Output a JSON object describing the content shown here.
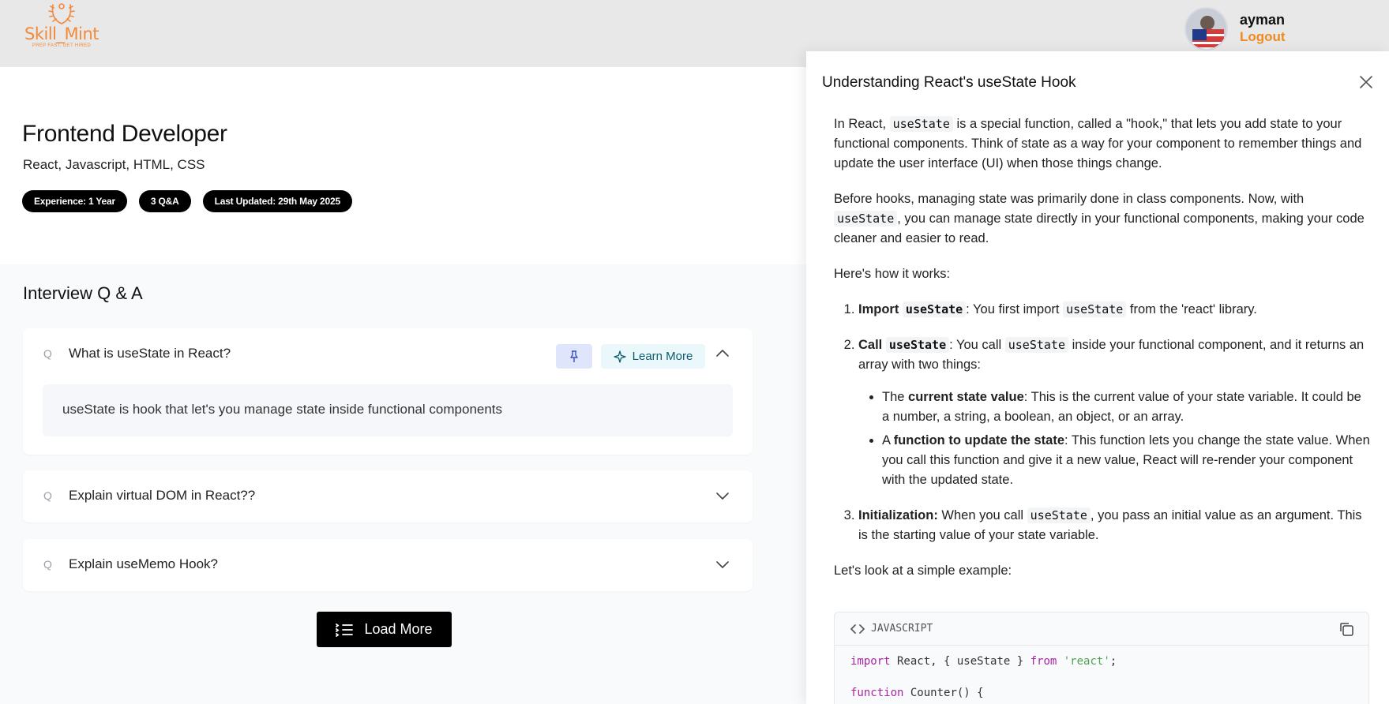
{
  "brand": {
    "name": "Skill_Mint",
    "tagline": "PREP FAST, GET HIRED",
    "accent": "#f08a3c"
  },
  "user": {
    "name": "ayman",
    "logout_label": "Logout"
  },
  "role": {
    "title": "Frontend Developer",
    "skills": "React, Javascript, HTML, CSS",
    "tags": [
      "Experience: 1 Year",
      "3 Q&A",
      "Last Updated: 29th May 2025"
    ]
  },
  "qa": {
    "heading": "Interview Q & A",
    "q_prefix": "Q",
    "items": [
      {
        "question": "What is useState in React?",
        "answer": "useState is hook that let's you manage state inside functional components",
        "expanded": true
      },
      {
        "question": "Explain virtual DOM in React??",
        "expanded": false
      },
      {
        "question": "Explain useMemo Hook?",
        "expanded": false
      }
    ],
    "learn_more_label": "Learn More",
    "load_more_label": "Load More"
  },
  "drawer": {
    "title": "Understanding React's useState Hook",
    "intro_a": "In React, ",
    "code_usestate": "useState",
    "intro_b": " is a special function, called a \"hook,\" that lets you add state to your functional components. Think of state as a way for your component to remember things and update the user interface (UI) when those things change.",
    "p2_a": "Before hooks, managing state was primarily done in class components. Now, with ",
    "p2_b": ", you can manage state directly in your functional components, making your code cleaner and easier to read.",
    "p3": "Here's how it works:",
    "step1_label": "Import ",
    "step1_a": ": You first import ",
    "step1_b": " from the 'react' library.",
    "step2_label": "Call ",
    "step2_a": ": You call ",
    "step2_b": " inside your functional component, and it returns an array with two things:",
    "bullet1_a": "The ",
    "bullet1_bold": "current state value",
    "bullet1_b": ": This is the current value of your state variable. It could be a number, a string, a boolean, an object, or an array.",
    "bullet2_a": "A ",
    "bullet2_bold": "function to update the state",
    "bullet2_b": ": This function lets you change the state value. When you call this function and give it a new value, React will re-render your component with the updated state.",
    "step3_label": "Initialization:",
    "step3_a": " When you call ",
    "step3_b": ", you pass an initial value as an argument. This is the starting value of your state variable.",
    "p4": "Let's look at a simple example:",
    "code_lang": "JAVASCRIPT",
    "code_import_kw": "import",
    "code_import_mid": " React, { useState } ",
    "code_from_kw": "from",
    "code_module": "'react'",
    "code_import_end": ";",
    "code_fn_kw": "function",
    "code_fn_rest": " Counter() {"
  }
}
